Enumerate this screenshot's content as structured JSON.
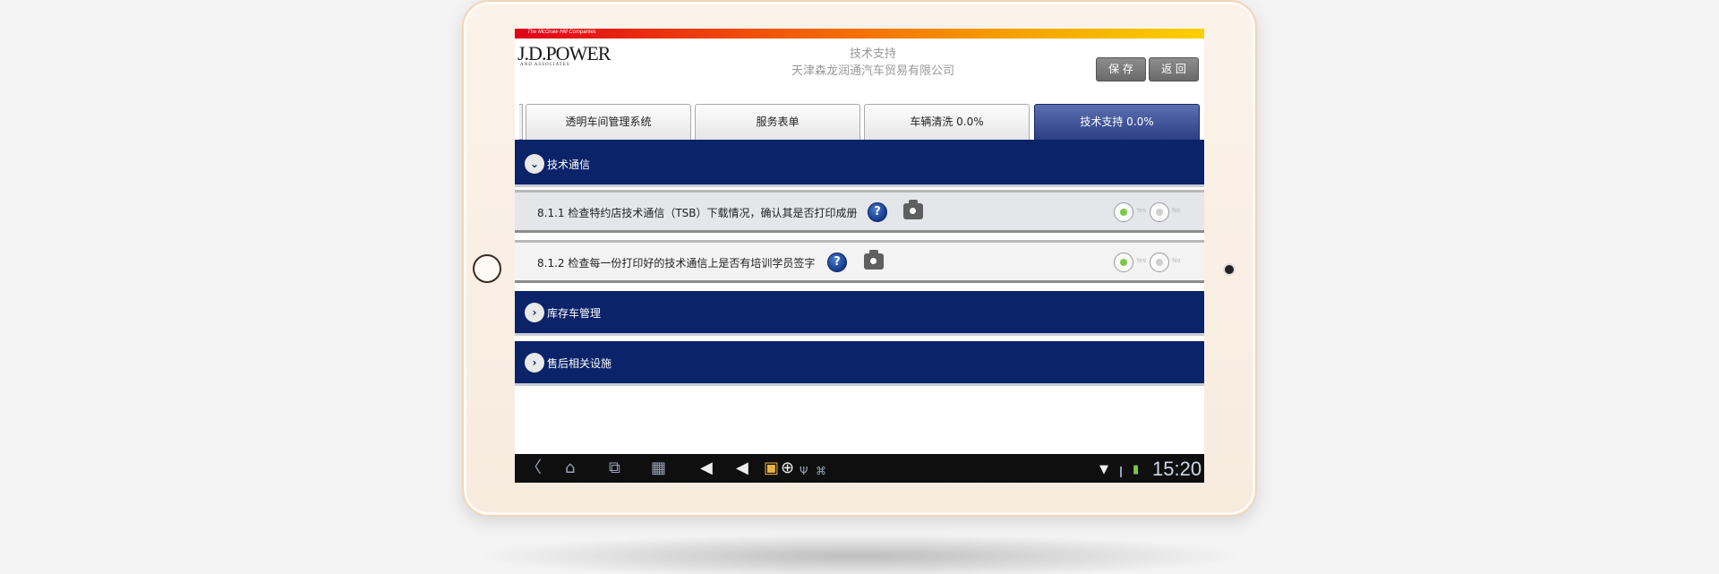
{
  "header": {
    "brand_company": "The McGraw·Hill Companies",
    "logo_text": "J.D.POWER",
    "logo_sub": "AND ASSOCIATES",
    "title": "技术支持",
    "dealer": "天津森龙润通汽车贸易有限公司",
    "save_label": "保 存",
    "back_label": "返 回"
  },
  "tabs": [
    {
      "label": "透明车间管理系统",
      "active": false
    },
    {
      "label": "服务表单",
      "active": false
    },
    {
      "label": "车辆清洗 0.0%",
      "active": false
    },
    {
      "label": "技术支持 0.0%",
      "active": true
    }
  ],
  "sections": [
    {
      "title": "技术通信",
      "expanded": true,
      "icon": "chevron-down-icon"
    },
    {
      "title": "库存车管理",
      "expanded": false,
      "icon": "chevron-right-icon"
    },
    {
      "title": "售后相关设施",
      "expanded": false,
      "icon": "chevron-right-icon"
    }
  ],
  "items": [
    {
      "text": "8.1.1 检查特约店技术通信（TSB）下载情况，确认其是否打印成册",
      "yes": "Yes",
      "no": "No",
      "selected": "yes"
    },
    {
      "text": "8.1.2 检查每一份打印好的技术通信上是否有培训学员签字",
      "yes": "Yes",
      "no": "No",
      "selected": "yes"
    }
  ],
  "statusbar": {
    "time": "15:20"
  },
  "colors": {
    "navy": "#0b2369",
    "accent_red": "#e2001a",
    "accent_yellow": "#fcd000",
    "radio_green": "#7ac943"
  }
}
